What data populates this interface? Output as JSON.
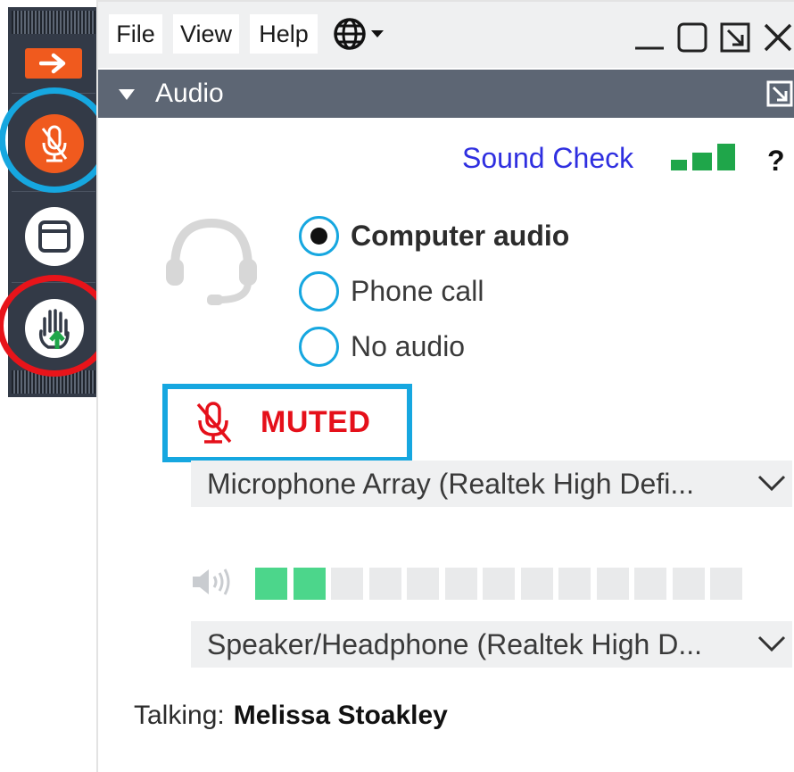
{
  "toolbar": {
    "icons": [
      "arrow-right-icon",
      "microphone-muted-icon",
      "window-icon",
      "raise-hand-icon"
    ]
  },
  "menu": {
    "file": "File",
    "view": "View",
    "help": "Help"
  },
  "audio_panel": {
    "title": "Audio",
    "sound_check": "Sound Check",
    "help_mark": "?",
    "options": [
      {
        "label": "Computer audio",
        "selected": true
      },
      {
        "label": "Phone call",
        "selected": false
      },
      {
        "label": "No audio",
        "selected": false
      }
    ],
    "mute_status": "MUTED",
    "microphone": "Microphone Array (Realtek High Defi...",
    "speaker_level_segments_on": 2,
    "speaker_level_segments_total": 13,
    "speaker": "Speaker/Headphone (Realtek High D...",
    "talking_label": "Talking:",
    "talking_name": "Melissa Stoakley"
  },
  "colors": {
    "accent_orange": "#f05a1e",
    "highlight_blue": "#16a7e0",
    "highlight_red": "#e8141a",
    "muted_red": "#e5101a",
    "header_gray": "#5d6674",
    "toolbar_dark": "#333a47",
    "link_blue": "#2f2fe0",
    "signal_green": "#1fa64a",
    "meter_green": "#4cd68b"
  }
}
